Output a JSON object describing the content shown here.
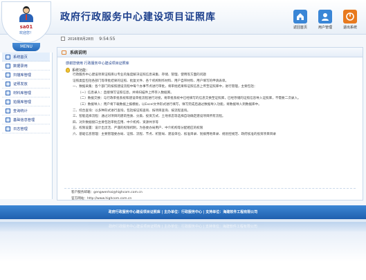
{
  "header": {
    "title": "政府行政服务中心建设项目证照库"
  },
  "user": {
    "name": "sa01",
    "welcome": "欢迎您！"
  },
  "menu_label": "MENU",
  "top_buttons": [
    {
      "label": "返回首页",
      "icon": "home-icon",
      "color": "#3a86d6"
    },
    {
      "label": "用户管理",
      "icon": "user-icon",
      "color": "#3a86d6"
    },
    {
      "label": "退出系统",
      "icon": "exit-icon",
      "color": "#e87a1e"
    }
  ],
  "sidebar": {
    "items": [
      {
        "label": "系统首页"
      },
      {
        "label": "数据录用"
      },
      {
        "label": "扫描库管理"
      },
      {
        "label": "证照发放"
      },
      {
        "label": "材料库管理"
      },
      {
        "label": "拍摄库管理"
      },
      {
        "label": "查询统计"
      },
      {
        "label": "基础信息管理"
      },
      {
        "label": "日志管理"
      }
    ]
  },
  "datebar": {
    "date": "2016年8月28日",
    "time": "9:54:55"
  },
  "panel": {
    "title": "系统说明",
    "welcome": "感谢您使用 行政服务中心建设项目证照库",
    "func_label": "系统功能：",
    "lines": [
      {
        "text": "行政服务中心建设项目证照库以专业的角度解决证照信息采集、存储、管理、使用等方面的问题",
        "indent": 1
      },
      {
        "text": "证照类型包括各部门等审批结果的证照、批复文件、各个机构制作材料、用户自带材料、用户填写的申请表单。",
        "indent": 1
      },
      {
        "text": "一、数据采集：各个部门的按照建设流程中每个办事节点进行审批，将审批结果和证照信息上传至证照库中，进行管理，主要包括：",
        "indent": 1
      },
      {
        "text": "（一）信息录入：直接填写证照信息，并将扫描件上传存入数据库。",
        "indent": 2
      },
      {
        "text": "（二）数据交换：与行政审批系统和建设审批流程进行对接，将审批系统中已经填写的信息交换至证照库，已经存储的证照信息导入证照库，不需要二次录入。",
        "indent": 2
      },
      {
        "text": "（三）数据导入：用户将下载数据上报模板，以Excel文件形式进行填写，填写完成后通过数据导入功能，将数据导入到数据库中。",
        "indent": 2
      },
      {
        "text": "二、综合查询：以多种形式进行查询，包括按证照查询、按项目查询、按流程查询。",
        "indent": 1
      },
      {
        "text": "三、智能选择流程：通过对项目的建筑性质、分类、投资方式、土地状态等选择自动确定建设项目所有流程。",
        "indent": 1
      },
      {
        "text": "四、对外数据接口主要包括审批应用、中介机构、资源共享等",
        "indent": 1
      },
      {
        "text": "五、权限设置：设计出灵活、严谨的权限机制，为各委办局用户、中介机构等分配相应的权限",
        "indent": 1
      },
      {
        "text": "六、基础信息管理：主要管理委办局、证照、流程、节点、机管局、建设单位、核准目录、划拨用地目录、规划控规范、政府核准的投资项目目录",
        "indent": 1
      }
    ],
    "contact": [
      {
        "text": "客户服务邮箱：gengwenhai@highcom.com.cn"
      },
      {
        "text": "官方网站：http://www.highcom.com.cn"
      }
    ]
  },
  "footer": {
    "text": "政府行政服务中心建设项目证照库 | 主办单位：行政服务中心 | 支持单位：海建软件工程有限公司"
  }
}
